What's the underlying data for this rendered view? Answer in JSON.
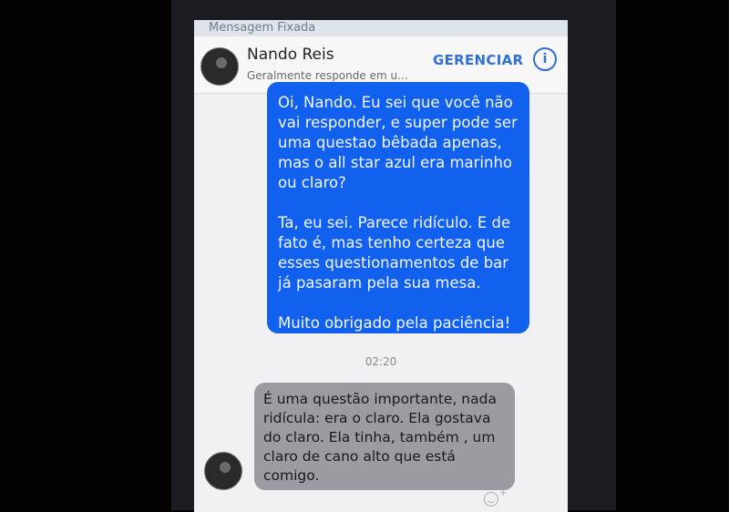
{
  "pinned": {
    "label": "Mensagem Fixada"
  },
  "header": {
    "contact_name": "Nando Reis",
    "status": "Geralmente responde em u...",
    "manage_label": "GERENCIAR",
    "info_icon": "info-icon"
  },
  "messages": {
    "outgoing": [
      "Oi, Nando. Eu sei que você não vai responder, e super pode ser uma questao bêbada apenas, mas o all star azul era marinho ou claro?",
      "Ta, eu sei. Parece ridículo.  E de fato é, mas tenho certeza que esses questionamentos de bar já pasaram pela sua mesa.",
      "Muito obrigado pela paciência!"
    ],
    "timestamp": "02:20",
    "incoming": "É uma questão importante, nada ridícula: era o claro. Ela gostava do claro. Ela tinha, também , um claro de cano alto que está comigo."
  },
  "colors": {
    "outgoing_bubble": "#1260ee",
    "incoming_bubble": "#9b9ca1",
    "accent": "#2f6fd6"
  }
}
